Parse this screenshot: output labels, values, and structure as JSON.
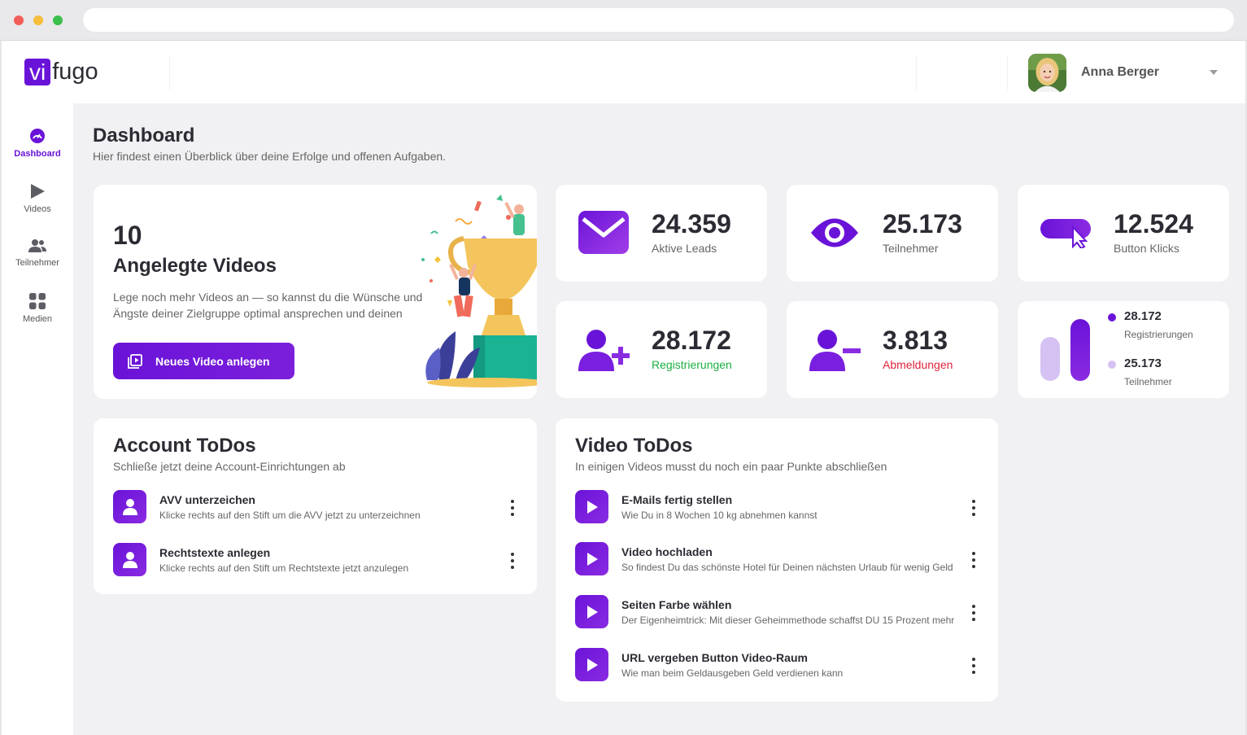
{
  "brand": {
    "logo_highlight": "vi",
    "logo_rest": "fugo",
    "accent": "#6a13d8"
  },
  "user": {
    "name": "Anna Berger"
  },
  "sidebar": {
    "items": [
      {
        "label": "Dashboard",
        "icon": "gauge-icon",
        "active": true
      },
      {
        "label": "Videos",
        "icon": "play-icon"
      },
      {
        "label": "Teilnehmer",
        "icon": "users-icon"
      },
      {
        "label": "Medien",
        "icon": "grid-icon"
      }
    ]
  },
  "page": {
    "title": "Dashboard",
    "subtitle": "Hier findest einen Überblick über deine Erfolge und offenen Aufgaben."
  },
  "hero": {
    "count": "10",
    "title": "Angelegte Videos",
    "text": "Lege noch mehr Videos an — so kannst du die Wünsche und Ängste deiner Zielgruppe optimal ansprechen und deinen",
    "button": "Neues Video anlegen"
  },
  "stats": {
    "leads": {
      "value": "24.359",
      "label": "Aktive Leads"
    },
    "participants": {
      "value": "25.173",
      "label": "Teilnehmer"
    },
    "clicks": {
      "value": "12.524",
      "label": "Button Klicks"
    },
    "registrations": {
      "value": "28.172",
      "label": "Registrierungen"
    },
    "unsubscribes": {
      "value": "3.813",
      "label": "Abmeldungen"
    },
    "comparison": {
      "a": {
        "value": "28.172",
        "label": "Registrierungen",
        "color": "#6a13d8"
      },
      "b": {
        "value": "25.173",
        "label": "Teilnehmer",
        "color": "#d5c2f3"
      }
    }
  },
  "account_todos": {
    "title": "Account ToDos",
    "subtitle": "Schließe jetzt deine Account-Einrichtungen ab",
    "items": [
      {
        "title": "AVV unterzeichen",
        "desc": "Klicke rechts auf den Stift um die AVV jetzt zu unterzeichnen"
      },
      {
        "title": "Rechtstexte anlegen",
        "desc": "Klicke rechts auf den Stift um Rechtstexte jetzt anzulegen"
      }
    ]
  },
  "video_todos": {
    "title": "Video ToDos",
    "subtitle": "In einigen Videos musst du noch ein paar Punkte abschließen",
    "items": [
      {
        "title": "E-Mails fertig stellen",
        "desc": "Wie Du in 8 Wochen 10 kg abnehmen kannst"
      },
      {
        "title": "Video hochladen",
        "desc": "So findest Du das schönste Hotel für Deinen nächsten Urlaub für wenig Geld"
      },
      {
        "title": "Seiten Farbe wählen",
        "desc": "Der Eigenheimtrick: Mit dieser Geheimmethode schaffst DU 15 Prozent mehr"
      },
      {
        "title": "URL vergeben Button Video-Raum",
        "desc": "Wie man beim Geldausgeben Geld verdienen kann"
      }
    ]
  }
}
